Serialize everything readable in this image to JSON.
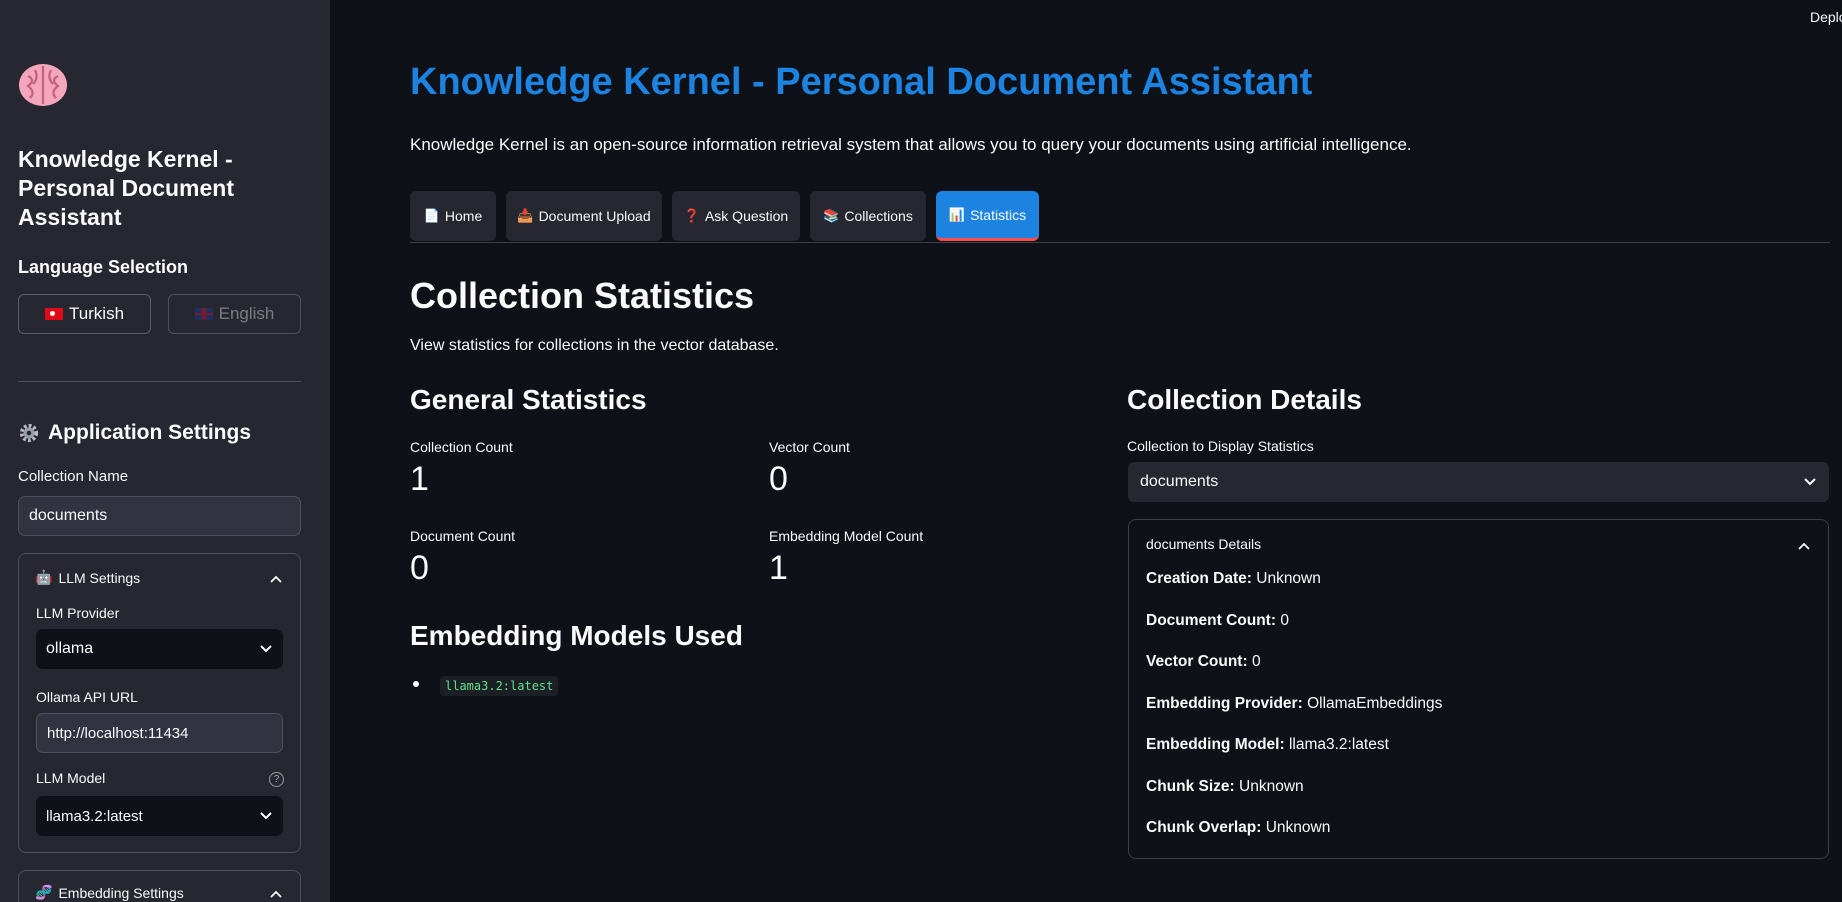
{
  "sidebar": {
    "title": "Knowledge Kernel - Personal Document Assistant",
    "language_label": "Language Selection",
    "lang_turkish": "Turkish",
    "lang_english": "English",
    "app_settings": "Application Settings",
    "collection_name_label": "Collection Name",
    "collection_name_value": "documents",
    "llm_settings": {
      "title": "LLM Settings",
      "provider_label": "LLM Provider",
      "provider_value": "ollama",
      "api_url_label": "Ollama API URL",
      "api_url_value": "http://localhost:11434",
      "model_label": "LLM Model",
      "model_value": "llama3.2:latest"
    },
    "embedding_settings": {
      "title": "Embedding Settings"
    }
  },
  "header": {
    "deploy": "Deploy"
  },
  "main": {
    "title": "Knowledge Kernel - Personal Document Assistant",
    "intro": "Knowledge Kernel is an open-source information retrieval system that allows you to query your documents using artificial intelligence.",
    "tabs": [
      {
        "label": "Home",
        "icon": "page-icon"
      },
      {
        "label": "Document Upload",
        "icon": "inbox-tray-icon"
      },
      {
        "label": "Ask Question",
        "icon": "question-icon"
      },
      {
        "label": "Collections",
        "icon": "books-icon"
      },
      {
        "label": "Statistics",
        "icon": "bar-chart-icon"
      }
    ],
    "active_tab": "Statistics",
    "heading": "Collection Statistics",
    "subheading": "View statistics for collections in the vector database.",
    "general": {
      "title": "General Statistics",
      "metrics": [
        {
          "label": "Collection Count",
          "value": "1"
        },
        {
          "label": "Vector Count",
          "value": "0"
        },
        {
          "label": "Document Count",
          "value": "0"
        },
        {
          "label": "Embedding Model Count",
          "value": "1"
        }
      ]
    },
    "models": {
      "title": "Embedding Models Used",
      "items": [
        "llama3.2:latest"
      ]
    },
    "details": {
      "title": "Collection Details",
      "select_label": "Collection to Display Statistics",
      "select_value": "documents",
      "box_title": "documents Details",
      "rows": [
        {
          "key": "Creation Date:",
          "value": "Unknown"
        },
        {
          "key": "Document Count:",
          "value": "0"
        },
        {
          "key": "Vector Count:",
          "value": "0"
        },
        {
          "key": "Embedding Provider:",
          "value": "OllamaEmbeddings"
        },
        {
          "key": "Embedding Model:",
          "value": "llama3.2:latest"
        },
        {
          "key": "Chunk Size:",
          "value": "Unknown"
        },
        {
          "key": "Chunk Overlap:",
          "value": "Unknown"
        }
      ]
    }
  },
  "colors": {
    "accent": "#1c83e1",
    "background": "#0e1117",
    "sidebar": "#262730",
    "tab_underline": "#ff4b4b"
  }
}
